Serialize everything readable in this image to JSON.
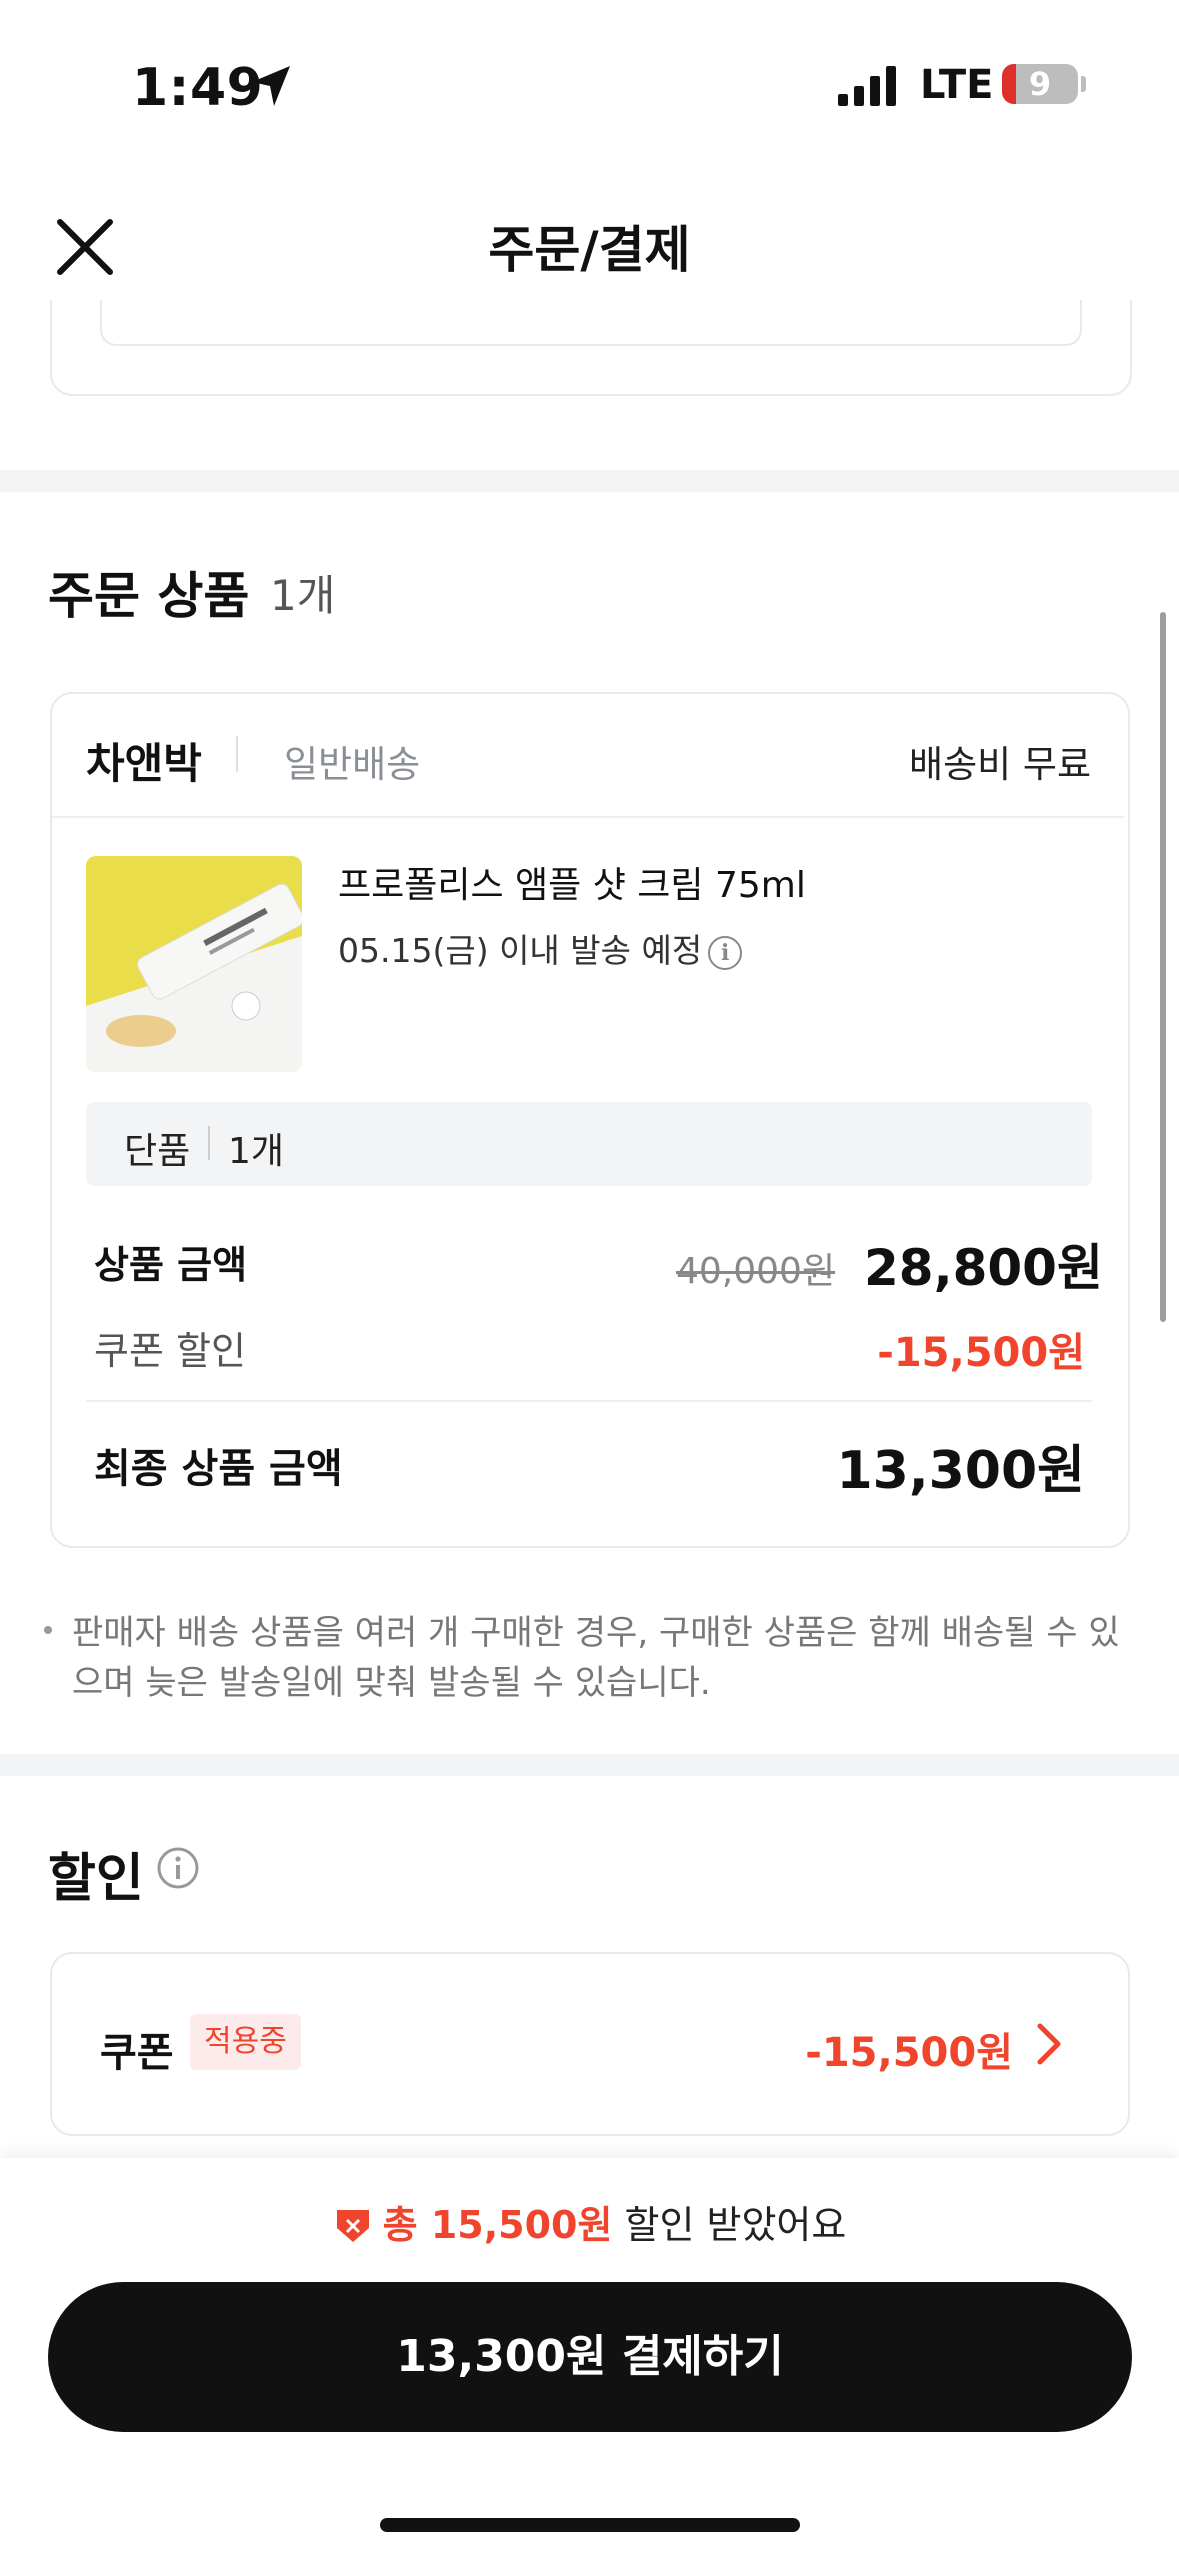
{
  "status_bar": {
    "time": "1:49",
    "network": "LTE",
    "battery": "9"
  },
  "header": {
    "title": "주문/결제"
  },
  "order_section": {
    "title": "주문 상품",
    "count": "1개"
  },
  "seller": {
    "name": "차앤박",
    "shipping_type": "일반배송",
    "shipping_fee": "배송비 무료"
  },
  "product": {
    "name": "프로폴리스 앰플 샷 크림 75ml",
    "ship_date": "05.15(금) 이내 발송 예정",
    "option_name": "단품",
    "option_qty": "1개"
  },
  "price": {
    "label": "상품 금액",
    "original": "40,000원",
    "current": "28,800원",
    "coupon_label": "쿠폰 할인",
    "coupon_value": "-15,500원",
    "final_label": "최종 상품 금액",
    "final_value": "13,300원"
  },
  "note": "판매자 배송 상품을 여러 개 구매한 경우, 구매한 상품은 함께 배송될 수 있으며 늦은 발송일에 맞춰 발송될 수 있습니다.",
  "discount": {
    "title": "할인",
    "coupon_label": "쿠폰",
    "coupon_badge": "적용중",
    "coupon_amount": "-15,500원"
  },
  "bottom": {
    "saved_prefix": "총 15,500원",
    "saved_suffix": " 할인 받았어요",
    "pay_button": "13,300원 결제하기"
  },
  "colors": {
    "accent_red": "#f0442c",
    "button_bg": "#111111"
  }
}
